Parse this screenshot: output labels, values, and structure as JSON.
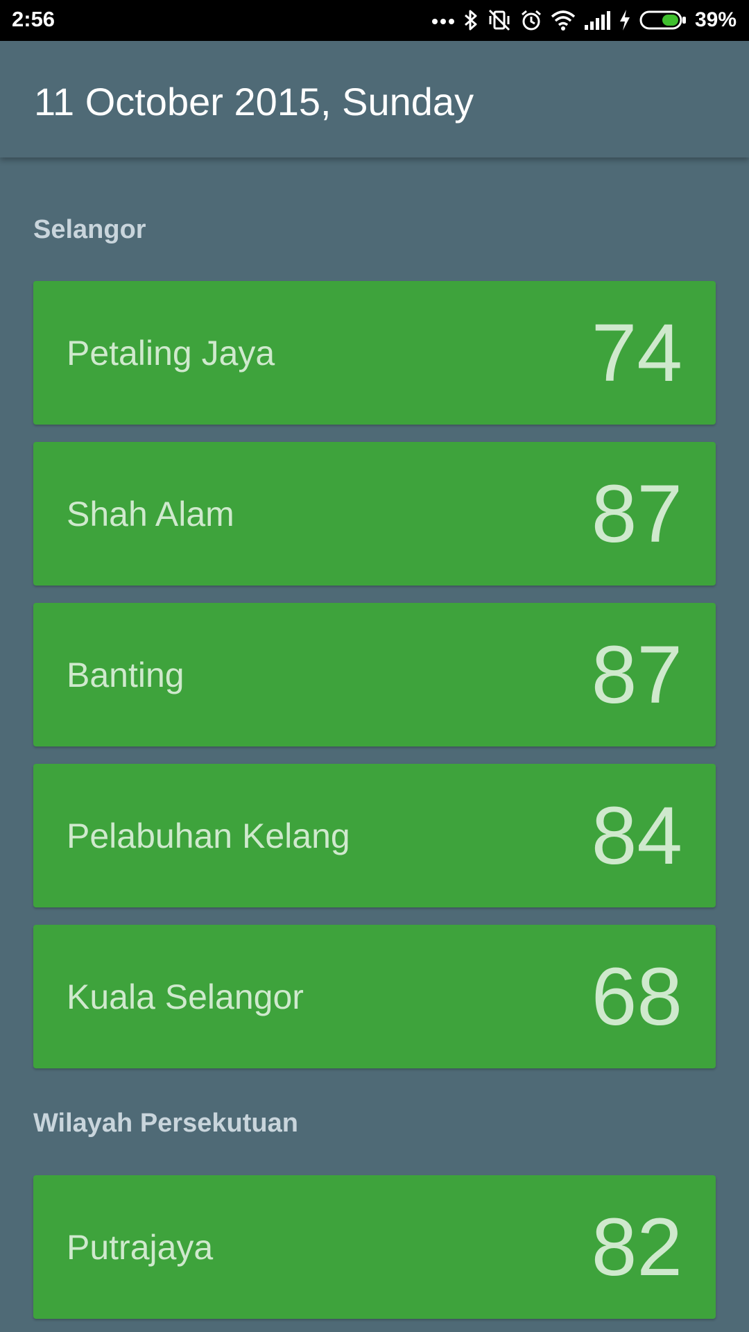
{
  "status_bar": {
    "time": "2:56",
    "battery_percent": "39%",
    "battery_level": 0.39,
    "icons": [
      "more-dots-icon",
      "bluetooth-icon",
      "vibrate-off-icon",
      "alarm-icon",
      "wifi-icon",
      "signal-icon",
      "charging-icon",
      "battery-icon"
    ]
  },
  "header": {
    "title": "11 October 2015, Sunday"
  },
  "sections": [
    {
      "title": "Selangor",
      "items": [
        {
          "name": "Petaling Jaya",
          "value": "74"
        },
        {
          "name": "Shah Alam",
          "value": "87"
        },
        {
          "name": "Banting",
          "value": "87"
        },
        {
          "name": "Pelabuhan Kelang",
          "value": "84"
        },
        {
          "name": "Kuala Selangor",
          "value": "68"
        }
      ]
    },
    {
      "title": "Wilayah Persekutuan",
      "items": [
        {
          "name": "Putrajaya",
          "value": "82"
        }
      ]
    }
  ],
  "colors": {
    "background": "#4f6a76",
    "card": "#3ea33c",
    "card_text": "#cfe9cd",
    "section_text": "#c9d5dc",
    "status_bar": "#000000",
    "battery_fill": "#3fbf2e"
  }
}
